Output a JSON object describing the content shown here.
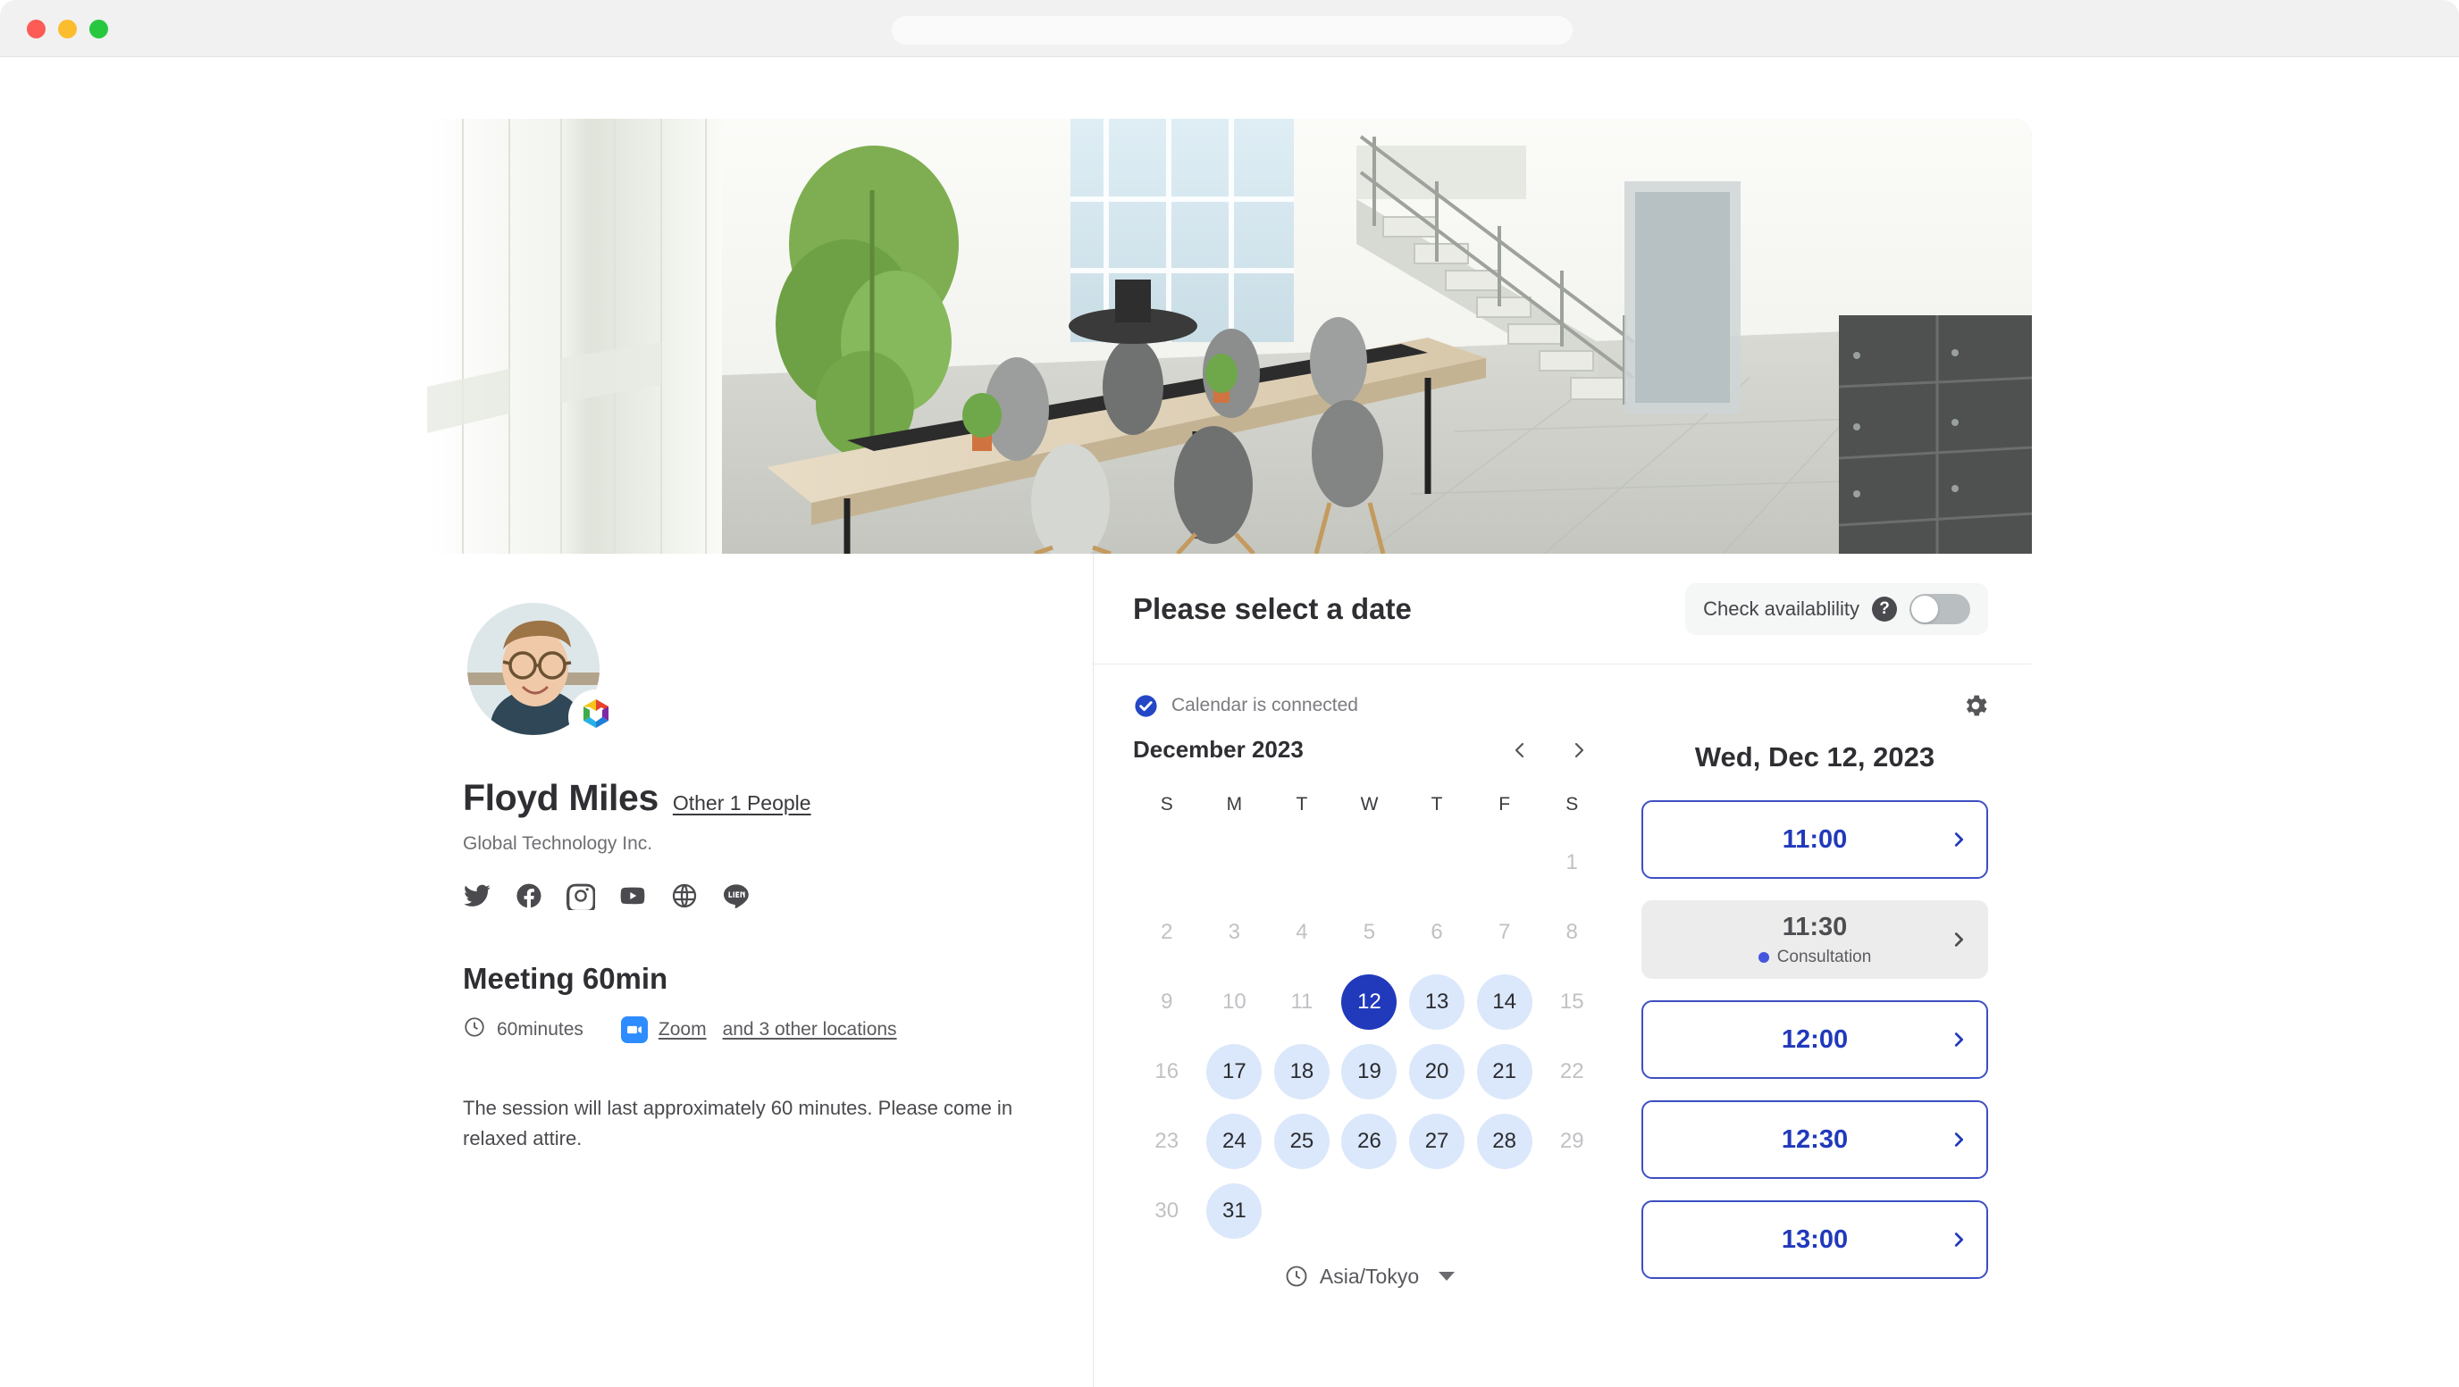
{
  "browser": {
    "traffic_lights": [
      "close",
      "minimize",
      "maximize"
    ],
    "address_bar_value": "",
    "address_bar_placeholder": ""
  },
  "hero": {
    "alt": "Modern open-plan office with long wooden table, chairs, stairs and plants"
  },
  "profile": {
    "avatar_alt": "Portrait of Floyd Miles wearing glasses",
    "badge_icon": "hexagon-logo-icon",
    "name": "Floyd Miles",
    "other_people_link": "Other 1 People",
    "company": "Global Technology Inc.",
    "social_links": [
      {
        "icon": "twitter-icon",
        "label": "Twitter"
      },
      {
        "icon": "facebook-icon",
        "label": "Facebook"
      },
      {
        "icon": "instagram-icon",
        "label": "Instagram"
      },
      {
        "icon": "youtube-icon",
        "label": "YouTube"
      },
      {
        "icon": "globe-icon",
        "label": "Website"
      },
      {
        "icon": "line-icon",
        "label": "LINE"
      }
    ]
  },
  "meeting": {
    "title": "Meeting 60min",
    "duration_icon": "clock-icon",
    "duration": "60minutes",
    "location_icon": "video-camera-icon",
    "location_primary": "Zoom",
    "location_more": "and 3 other locations",
    "description": "The session will last approximately 60 minutes. Please come in relaxed attire."
  },
  "date_panel": {
    "title": "Please select a date",
    "availability_label": "Check availablility",
    "help_icon": "question-mark-icon",
    "help_glyph": "?",
    "toggle_state": "off",
    "calendar_status_icon": "check-circle-icon",
    "calendar_status": "Calendar is connected",
    "settings_icon": "gear-icon"
  },
  "calendar": {
    "month_label": "December 2023",
    "prev_icon": "chevron-left-icon",
    "next_icon": "chevron-right-icon",
    "weekdays": [
      "S",
      "M",
      "T",
      "W",
      "T",
      "F",
      "S"
    ],
    "cells": [
      {
        "label": "",
        "state": "empty"
      },
      {
        "label": "",
        "state": "empty"
      },
      {
        "label": "",
        "state": "empty"
      },
      {
        "label": "",
        "state": "empty"
      },
      {
        "label": "",
        "state": "empty"
      },
      {
        "label": "",
        "state": "empty"
      },
      {
        "label": "1",
        "state": "disabled"
      },
      {
        "label": "2",
        "state": "disabled"
      },
      {
        "label": "3",
        "state": "disabled"
      },
      {
        "label": "4",
        "state": "disabled"
      },
      {
        "label": "5",
        "state": "disabled"
      },
      {
        "label": "6",
        "state": "disabled"
      },
      {
        "label": "7",
        "state": "disabled"
      },
      {
        "label": "8",
        "state": "disabled"
      },
      {
        "label": "9",
        "state": "disabled"
      },
      {
        "label": "10",
        "state": "disabled"
      },
      {
        "label": "11",
        "state": "disabled"
      },
      {
        "label": "12",
        "state": "selected"
      },
      {
        "label": "13",
        "state": "available"
      },
      {
        "label": "14",
        "state": "available"
      },
      {
        "label": "15",
        "state": "disabled"
      },
      {
        "label": "16",
        "state": "disabled"
      },
      {
        "label": "17",
        "state": "available"
      },
      {
        "label": "18",
        "state": "available"
      },
      {
        "label": "19",
        "state": "available"
      },
      {
        "label": "20",
        "state": "available"
      },
      {
        "label": "21",
        "state": "available"
      },
      {
        "label": "22",
        "state": "disabled"
      },
      {
        "label": "23",
        "state": "disabled"
      },
      {
        "label": "24",
        "state": "available"
      },
      {
        "label": "25",
        "state": "available"
      },
      {
        "label": "26",
        "state": "available"
      },
      {
        "label": "27",
        "state": "available"
      },
      {
        "label": "28",
        "state": "available"
      },
      {
        "label": "29",
        "state": "disabled"
      },
      {
        "label": "30",
        "state": "disabled"
      },
      {
        "label": "31",
        "state": "available"
      },
      {
        "label": "",
        "state": "empty"
      },
      {
        "label": "",
        "state": "empty"
      },
      {
        "label": "",
        "state": "empty"
      },
      {
        "label": "",
        "state": "empty"
      },
      {
        "label": "",
        "state": "empty"
      }
    ],
    "timezone_icon": "clock-icon",
    "timezone": "Asia/Tokyo",
    "timezone_caret": "caret-down-icon"
  },
  "slots": {
    "date_title": "Wed, Dec 12, 2023",
    "chevron_icon": "chevron-right-icon",
    "items": [
      {
        "time": "11:00",
        "state": "open",
        "sub": ""
      },
      {
        "time": "11:30",
        "state": "booked",
        "sub": "Consultation"
      },
      {
        "time": "12:00",
        "state": "open",
        "sub": ""
      },
      {
        "time": "12:30",
        "state": "open",
        "sub": ""
      },
      {
        "time": "13:00",
        "state": "open",
        "sub": ""
      }
    ]
  },
  "colors": {
    "primary": "#2139bb",
    "slot_border": "#3c4fc4",
    "available_day_bg": "#dbe8fb",
    "booked_slot_bg": "#ececec",
    "dot": "#4455dd",
    "zoom_blue": "#2d8cff",
    "toggle_off": "#b9bec1"
  }
}
